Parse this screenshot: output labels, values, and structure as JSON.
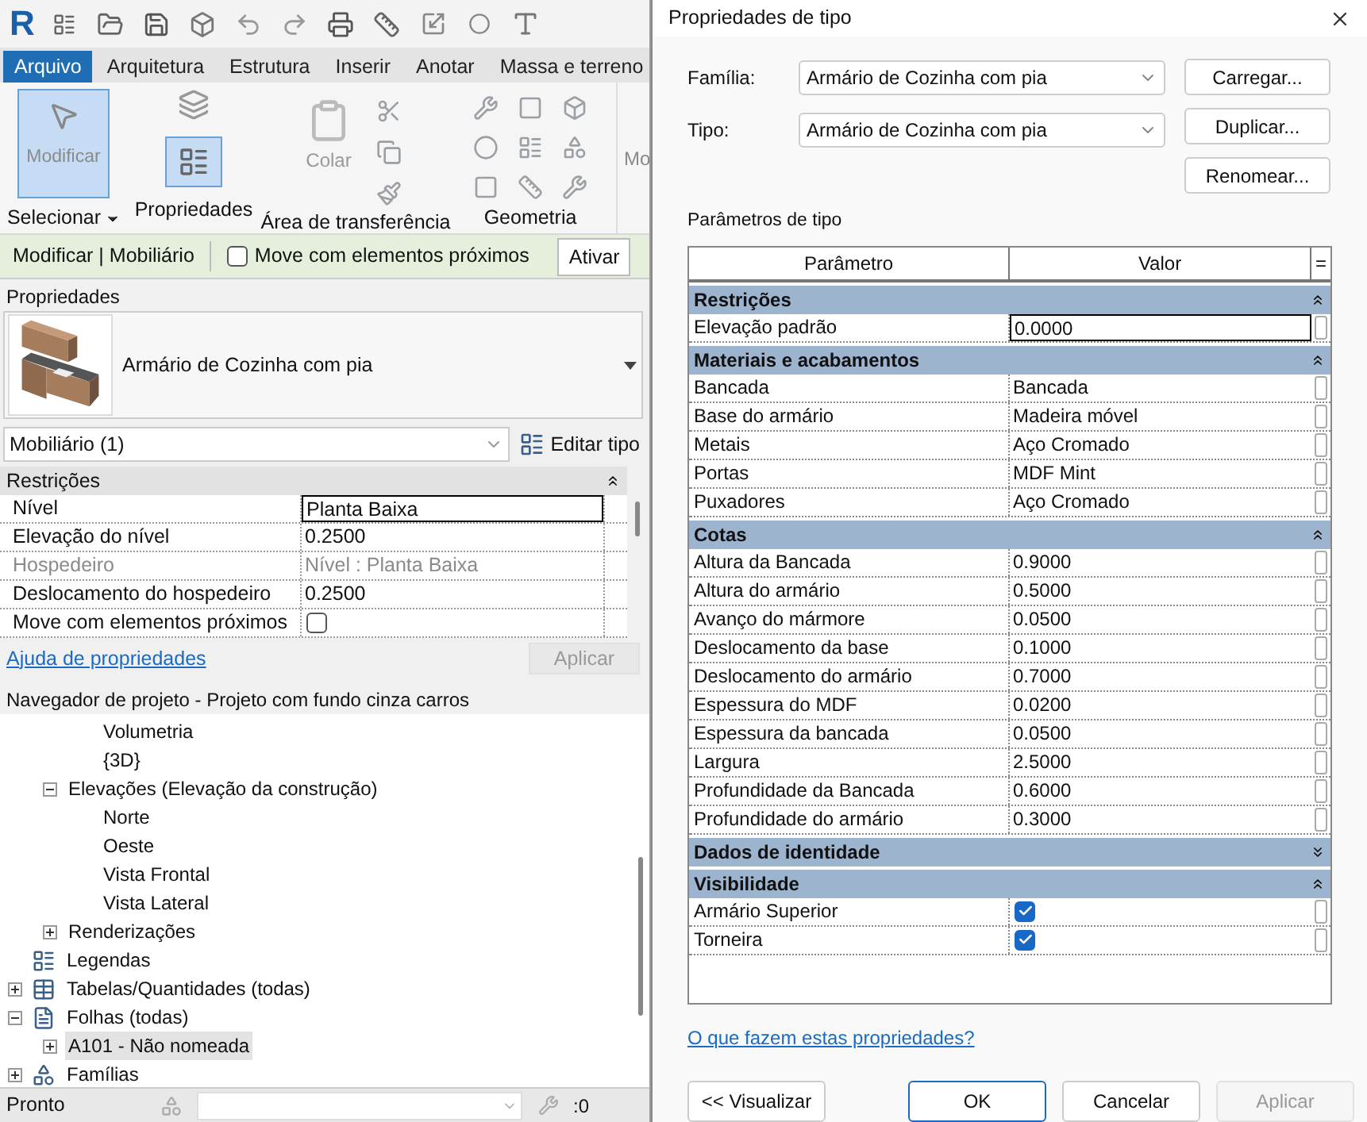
{
  "toolbar": {
    "logo": "R"
  },
  "ribbon_tabs": [
    {
      "label": "Arquivo",
      "selected": true
    },
    {
      "label": "Arquitetura",
      "selected": false
    },
    {
      "label": "Estrutura",
      "selected": false
    },
    {
      "label": "Inserir",
      "selected": false
    },
    {
      "label": "Anotar",
      "selected": false
    },
    {
      "label": "Massa e terreno",
      "selected": false
    }
  ],
  "ribbon": {
    "modify_button": {
      "label": "Modificar",
      "selected": true
    },
    "properties_button": {
      "selected": true
    },
    "paste_button": {
      "label": "Colar",
      "disabled": true
    },
    "cut_off_button": "Mo",
    "select_dropdown": true,
    "panels": [
      "Selecionar",
      "Propriedades",
      "Área de transferência",
      "Geometria"
    ]
  },
  "context_bar": {
    "title": "Modificar | Mobiliário",
    "move_checkbox": {
      "label": "Move com elementos próximos",
      "checked": false
    },
    "cut_off_button": "Ativar"
  },
  "properties": {
    "title": "Propriedades",
    "type_name": "Armário de Cozinha com pia",
    "filter": "Mobiliário (1)",
    "edit_type_button": "Editar tipo",
    "groups": [
      {
        "label": "Restrições",
        "expanded": true,
        "rows": [
          {
            "label": "Nível",
            "value": "Planta Baixa",
            "kind": "edit"
          },
          {
            "label": "Elevação do nível",
            "value": "0.2500",
            "kind": "text"
          },
          {
            "label": "Hospedeiro",
            "value": "Nível : Planta Baixa",
            "kind": "readonly"
          },
          {
            "label": "Deslocamento do hospedeiro",
            "value": "0.2500",
            "kind": "text"
          },
          {
            "label": "Move com elementos próximos",
            "kind": "checkbox",
            "checked": false
          }
        ]
      }
    ],
    "help_link": "Ajuda de propriedades",
    "apply_button": {
      "label": "Aplicar",
      "disabled": true
    }
  },
  "project_browser": {
    "title": "Navegador de projeto - Projeto com fundo cinza carros",
    "tree": [
      {
        "children": [
          {
            "children": [
              {
                "label": "Volumetria",
                "selected": false
              },
              {
                "label": "{3D}",
                "selected": false
              }
            ]
          },
          {
            "label": "Elevações (Elevação da construção)",
            "expanded": true,
            "selected": false,
            "children": [
              {
                "label": "Norte",
                "selected": false
              },
              {
                "label": "Oeste",
                "selected": false
              },
              {
                "label": "Vista Frontal",
                "selected": false
              },
              {
                "label": "Vista Lateral",
                "selected": false
              }
            ]
          },
          {
            "label": "Renderizações",
            "expanded": false,
            "selected": false
          }
        ]
      },
      {
        "label": "Legendas",
        "kind": "legend",
        "selected": false
      },
      {
        "label": "Tabelas/Quantidades (todas)",
        "kind": "schedule",
        "expanded": false,
        "selected": false
      },
      {
        "label": "Folhas (todas)",
        "kind": "sheet",
        "expanded": true,
        "selected": false,
        "children": [
          {
            "label": "A101 - Não nomeada",
            "expanded": false,
            "selected": true
          }
        ]
      },
      {
        "label": "Famílias",
        "kind": "family",
        "expanded": false,
        "selected": false
      }
    ]
  },
  "status_bar": {
    "text": "Pronto",
    "selection_count": ":0"
  },
  "dialog": {
    "title": "Propriedades de tipo",
    "family": {
      "label": "Família:",
      "value": "Armário de Cozinha com pia"
    },
    "type": {
      "label": "Tipo:",
      "value": "Armário de Cozinha com pia"
    },
    "side_buttons": [
      "Carregar...",
      "Duplicar...",
      "Renomear..."
    ],
    "params_label": "Parâmetros de tipo",
    "columns": [
      "Parâmetro",
      "Valor",
      "="
    ],
    "groups": [
      {
        "label": "Restrições",
        "expanded": true,
        "rows": [
          {
            "label": "Elevação padrão",
            "value": "0.0000",
            "kind": "edit"
          }
        ]
      },
      {
        "label": "Materiais e acabamentos",
        "expanded": true,
        "rows": [
          {
            "label": "Bancada",
            "value": "Bancada",
            "kind": "text"
          },
          {
            "label": "Base do armário",
            "value": "Madeira móvel",
            "kind": "text"
          },
          {
            "label": "Metais",
            "value": "Aço Cromado",
            "kind": "text"
          },
          {
            "label": "Portas",
            "value": "MDF Mint",
            "kind": "text"
          },
          {
            "label": "Puxadores",
            "value": "Aço Cromado",
            "kind": "text"
          }
        ]
      },
      {
        "label": "Cotas",
        "expanded": true,
        "rows": [
          {
            "label": "Altura da Bancada",
            "value": "0.9000",
            "kind": "text"
          },
          {
            "label": "Altura do armário",
            "value": "0.5000",
            "kind": "text"
          },
          {
            "label": "Avanço do mármore",
            "value": "0.0500",
            "kind": "text"
          },
          {
            "label": "Deslocamento da base",
            "value": "0.1000",
            "kind": "text"
          },
          {
            "label": "Deslocamento do armário",
            "value": "0.7000",
            "kind": "text"
          },
          {
            "label": "Espessura do MDF",
            "value": "0.0200",
            "kind": "text"
          },
          {
            "label": "Espessura da bancada",
            "value": "0.0500",
            "kind": "text"
          },
          {
            "label": "Largura",
            "value": "2.5000",
            "kind": "text"
          },
          {
            "label": "Profundidade da Bancada",
            "value": "0.6000",
            "kind": "text"
          },
          {
            "label": "Profundidade do armário",
            "value": "0.3000",
            "kind": "text"
          }
        ]
      },
      {
        "label": "Dados de identidade",
        "expanded": false
      },
      {
        "label": "Visibilidade",
        "expanded": true,
        "rows": [
          {
            "label": "Armário Superior",
            "kind": "checkbox",
            "checked": true
          },
          {
            "label": "Torneira",
            "kind": "checkbox",
            "checked": true
          }
        ]
      }
    ],
    "help_link": "O que fazem estas propriedades?",
    "buttons": [
      {
        "label": "<< Visualizar",
        "kind": "normal"
      },
      {
        "label": "OK",
        "kind": "default"
      },
      {
        "label": "Cancelar",
        "kind": "normal"
      },
      {
        "label": "Aplicar",
        "kind": "disabled"
      }
    ]
  }
}
